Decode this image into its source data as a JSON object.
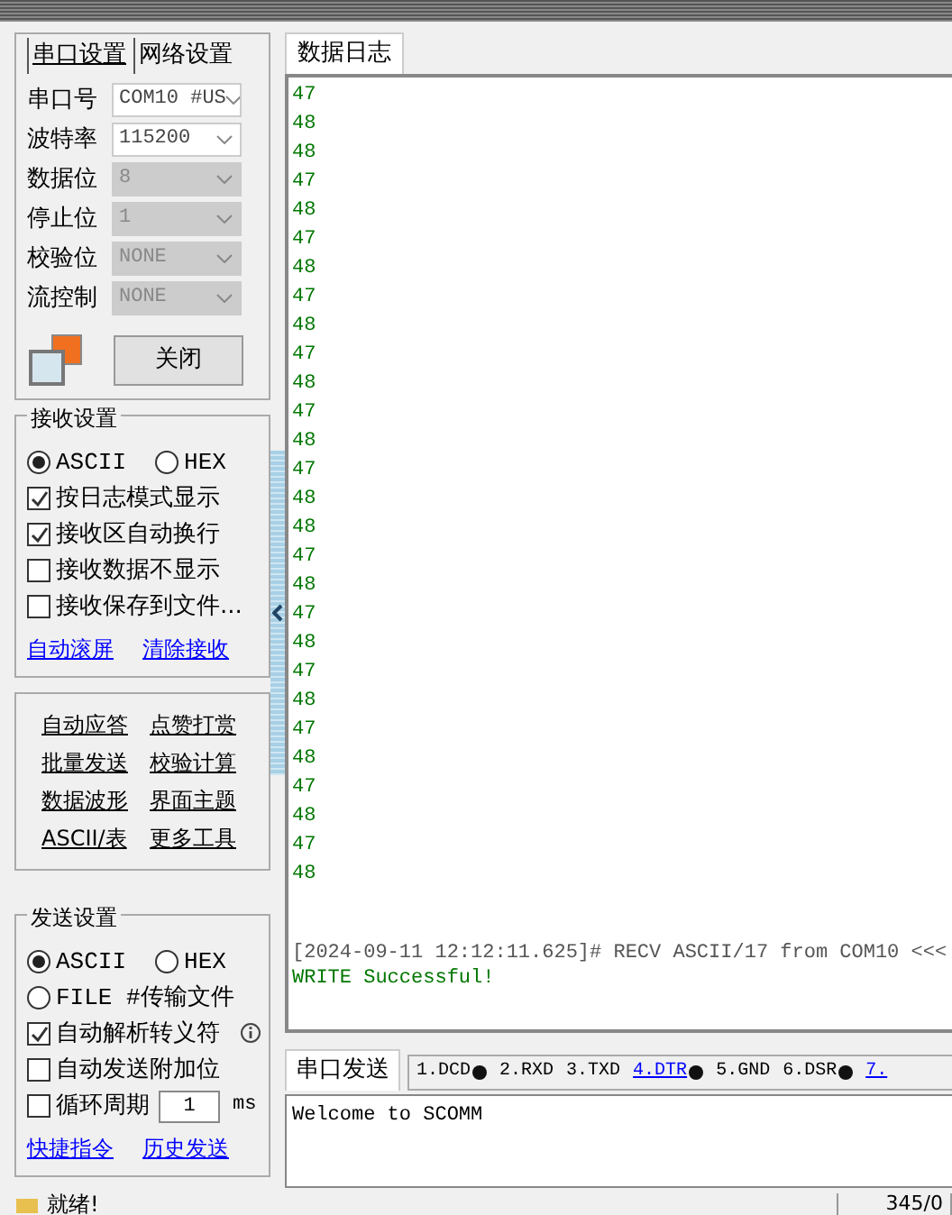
{
  "port_tabs": [
    {
      "label": "串口设置",
      "selected": true
    },
    {
      "label": "网络设置",
      "selected": false
    }
  ],
  "port_fields": [
    {
      "label": "串口号",
      "value": "COM10 #US",
      "disabled": false
    },
    {
      "label": "波特率",
      "value": "115200",
      "disabled": false
    },
    {
      "label": "数据位",
      "value": "8",
      "disabled": true
    },
    {
      "label": "停止位",
      "value": "1",
      "disabled": true
    },
    {
      "label": "校验位",
      "value": "NONE",
      "disabled": true
    },
    {
      "label": "流控制",
      "value": "NONE",
      "disabled": true
    }
  ],
  "close_button": "关闭",
  "receive": {
    "title": "接收设置",
    "radios": [
      {
        "label": "ASCII",
        "selected": true
      },
      {
        "label": "HEX",
        "selected": false
      }
    ],
    "checks": [
      {
        "label": "按日志模式显示",
        "checked": true
      },
      {
        "label": "接收区自动换行",
        "checked": true
      },
      {
        "label": "接收数据不显示",
        "checked": false
      },
      {
        "label": "接收保存到文件...",
        "checked": false
      }
    ],
    "links": [
      "自动滚屏",
      "清除接收"
    ]
  },
  "tools": [
    "自动应答",
    "点赞打赏",
    "批量发送",
    "校验计算",
    "数据波形",
    "界面主题",
    "ASCII/表",
    "更多工具"
  ],
  "send": {
    "title": "发送设置",
    "radios": [
      {
        "label": "ASCII",
        "selected": true
      },
      {
        "label": "HEX",
        "selected": false
      },
      {
        "label": "FILE #传输文件",
        "selected": false
      }
    ],
    "checks": [
      {
        "label": "自动解析转义符",
        "checked": true,
        "info": true
      },
      {
        "label": "自动发送附加位",
        "checked": false
      },
      {
        "label": "循环周期",
        "checked": false,
        "value": "1",
        "unit": "ms"
      }
    ],
    "links": [
      "快捷指令",
      "历史发送"
    ]
  },
  "log_tab": "数据日志",
  "log_lines": [
    "47",
    "48",
    "48",
    "47",
    "48",
    "47",
    "48",
    "47",
    "48",
    "47",
    "48",
    "47",
    "48",
    "47",
    "48",
    "48",
    "47",
    "48",
    "47",
    "48",
    "47",
    "48",
    "47",
    "48",
    "47",
    "48",
    "47",
    "48"
  ],
  "log_recv": "[2024-09-11 12:12:11.625]# RECV ASCII/17 from COM10 <<<",
  "log_write": "WRITE Successful!",
  "send_tab": "串口发送",
  "pins": [
    {
      "label": "1.DCD",
      "dot": true,
      "link": false
    },
    {
      "label": "2.RXD",
      "dot": false,
      "link": false
    },
    {
      "label": "3.TXD",
      "dot": false,
      "link": false
    },
    {
      "label": "4.DTR",
      "dot": true,
      "link": true
    },
    {
      "label": "5.GND",
      "dot": false,
      "link": false
    },
    {
      "label": "6.DSR",
      "dot": true,
      "link": false
    },
    {
      "label": "7.",
      "dot": false,
      "link": true
    }
  ],
  "send_text": "Welcome to SCOMM",
  "status": {
    "text": "就绪!",
    "counter": "345/0"
  }
}
